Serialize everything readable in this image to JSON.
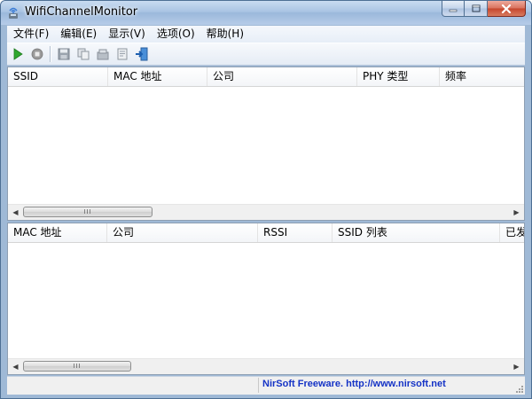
{
  "window": {
    "title": "WifiChannelMonitor"
  },
  "menu": [
    {
      "label": "文件(F)"
    },
    {
      "label": "编辑(E)"
    },
    {
      "label": "显示(V)"
    },
    {
      "label": "选项(O)"
    },
    {
      "label": "帮助(H)"
    }
  ],
  "toolbar": {
    "icons": [
      "start-icon",
      "stop-icon",
      "save-icon",
      "copy-icon",
      "properties-icon",
      "html-report-icon",
      "exit-icon"
    ]
  },
  "top_table": {
    "columns": [
      "SSID",
      "MAC 地址",
      "公司",
      "PHY 类型",
      "频率"
    ],
    "rows": [],
    "scroll_grip": "III"
  },
  "bottom_table": {
    "columns": [
      "MAC 地址",
      "公司",
      "RSSI",
      "SSID 列表",
      "已发"
    ],
    "rows": [],
    "scroll_grip": "III"
  },
  "status": {
    "link_text": "NirSoft Freeware.  http://www.nirsoft.net",
    "link_color": "#1533c6"
  },
  "colors": {
    "play_green": "#2fa82f",
    "stop_gray": "#8a8a8a",
    "close_red": "#c5452c"
  }
}
